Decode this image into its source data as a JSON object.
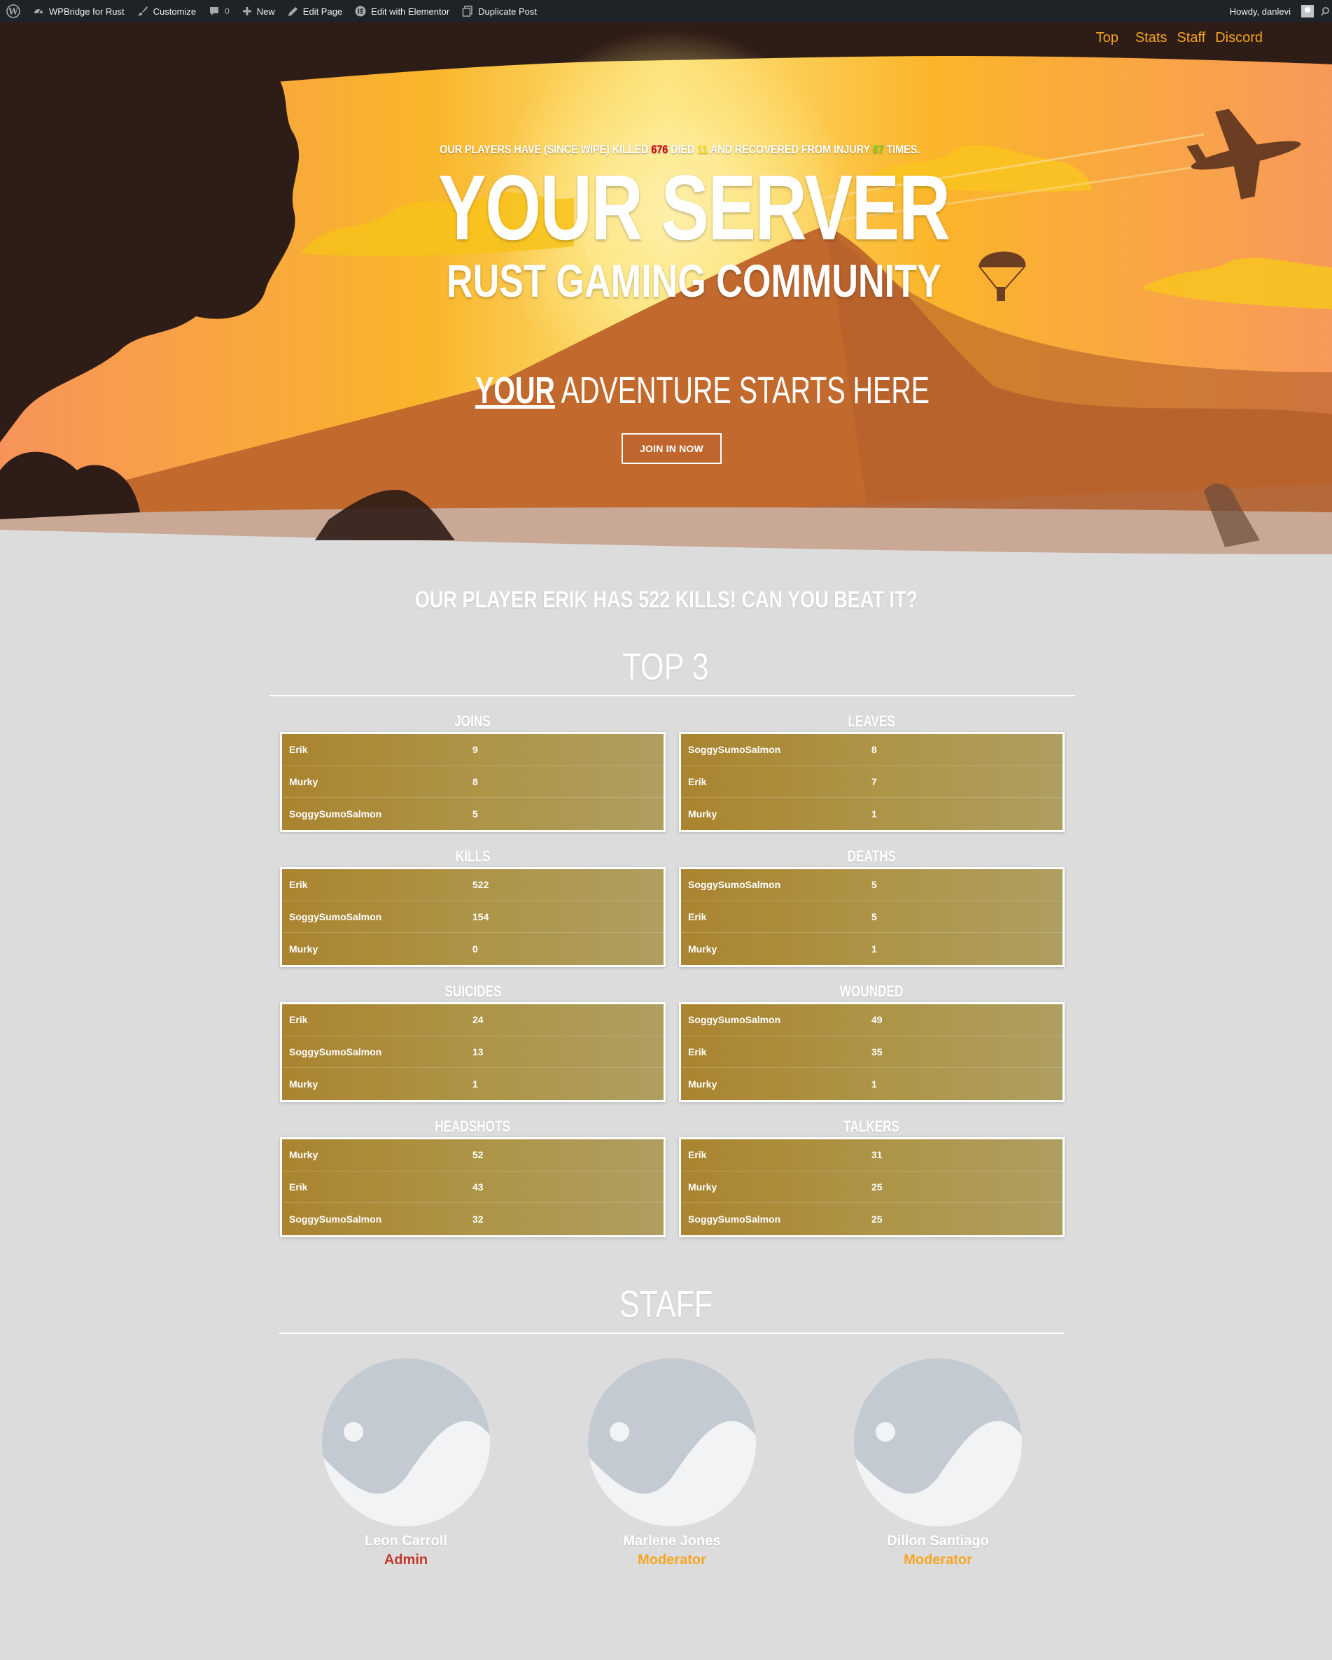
{
  "adminbar": {
    "site_name": "WPBridge for Rust",
    "customize": "Customize",
    "comments_count": "0",
    "new_label": "New",
    "edit_page": "Edit Page",
    "edit_elementor": "Edit with Elementor",
    "duplicate_post": "Duplicate Post",
    "howdy": "Howdy, danlevi"
  },
  "nav": {
    "items": [
      "Top",
      "Stats",
      "Staff",
      "Discord"
    ]
  },
  "hero": {
    "stat_prefix": "OUR PLAYERS HAVE (SINCE WIPE) KILLED",
    "kills": "676",
    "died_label": "DIED",
    "died": "11",
    "recovered_label": "AND RECOVERED FROM INJURY",
    "recovered": "87",
    "times_label": "TIMES.",
    "title": "YOUR SERVER",
    "subtitle": "RUST GAMING COMMUNITY",
    "adventure_your": "YOUR",
    "adventure_rest": " ADVENTURE STARTS HERE",
    "join_button": "JOIN IN NOW"
  },
  "headline": "OUR PLAYER ERIK HAS 522 KILLS! CAN YOU BEAT IT?",
  "top3": {
    "title": "TOP 3",
    "tables": [
      {
        "label": "JOINS",
        "rows": [
          [
            "Erik",
            "9"
          ],
          [
            "Murky",
            "8"
          ],
          [
            "SoggySumoSalmon",
            "5"
          ]
        ]
      },
      {
        "label": "LEAVES",
        "rows": [
          [
            "SoggySumoSalmon",
            "8"
          ],
          [
            "Erik",
            "7"
          ],
          [
            "Murky",
            "1"
          ]
        ]
      },
      {
        "label": "KILLS",
        "rows": [
          [
            "Erik",
            "522"
          ],
          [
            "SoggySumoSalmon",
            "154"
          ],
          [
            "Murky",
            "0"
          ]
        ]
      },
      {
        "label": "DEATHS",
        "rows": [
          [
            "SoggySumoSalmon",
            "5"
          ],
          [
            "Erik",
            "5"
          ],
          [
            "Murky",
            "1"
          ]
        ]
      },
      {
        "label": "SUICIDES",
        "rows": [
          [
            "Erik",
            "24"
          ],
          [
            "SoggySumoSalmon",
            "13"
          ],
          [
            "Murky",
            "1"
          ]
        ]
      },
      {
        "label": "WOUNDED",
        "rows": [
          [
            "SoggySumoSalmon",
            "49"
          ],
          [
            "Erik",
            "35"
          ],
          [
            "Murky",
            "1"
          ]
        ]
      },
      {
        "label": "HEADSHOTS",
        "rows": [
          [
            "Murky",
            "52"
          ],
          [
            "Erik",
            "43"
          ],
          [
            "SoggySumoSalmon",
            "32"
          ]
        ]
      },
      {
        "label": "TALKERS",
        "rows": [
          [
            "Erik",
            "31"
          ],
          [
            "Murky",
            "25"
          ],
          [
            "SoggySumoSalmon",
            "25"
          ]
        ]
      }
    ]
  },
  "staff": {
    "title": "STAFF",
    "members": [
      {
        "name": "Leon Carroll",
        "role": "Admin",
        "role_color": "#c0392b"
      },
      {
        "name": "Marlene Jones",
        "role": "Moderator",
        "role_color": "#f5a623"
      },
      {
        "name": "Dillon Santiago",
        "role": "Moderator",
        "role_color": "#f5a623"
      }
    ]
  },
  "colors": {
    "accent": "#f5a623",
    "admin": "#c0392b",
    "table_bg": "#ad9548",
    "page_bg": "#dcdcdc"
  }
}
